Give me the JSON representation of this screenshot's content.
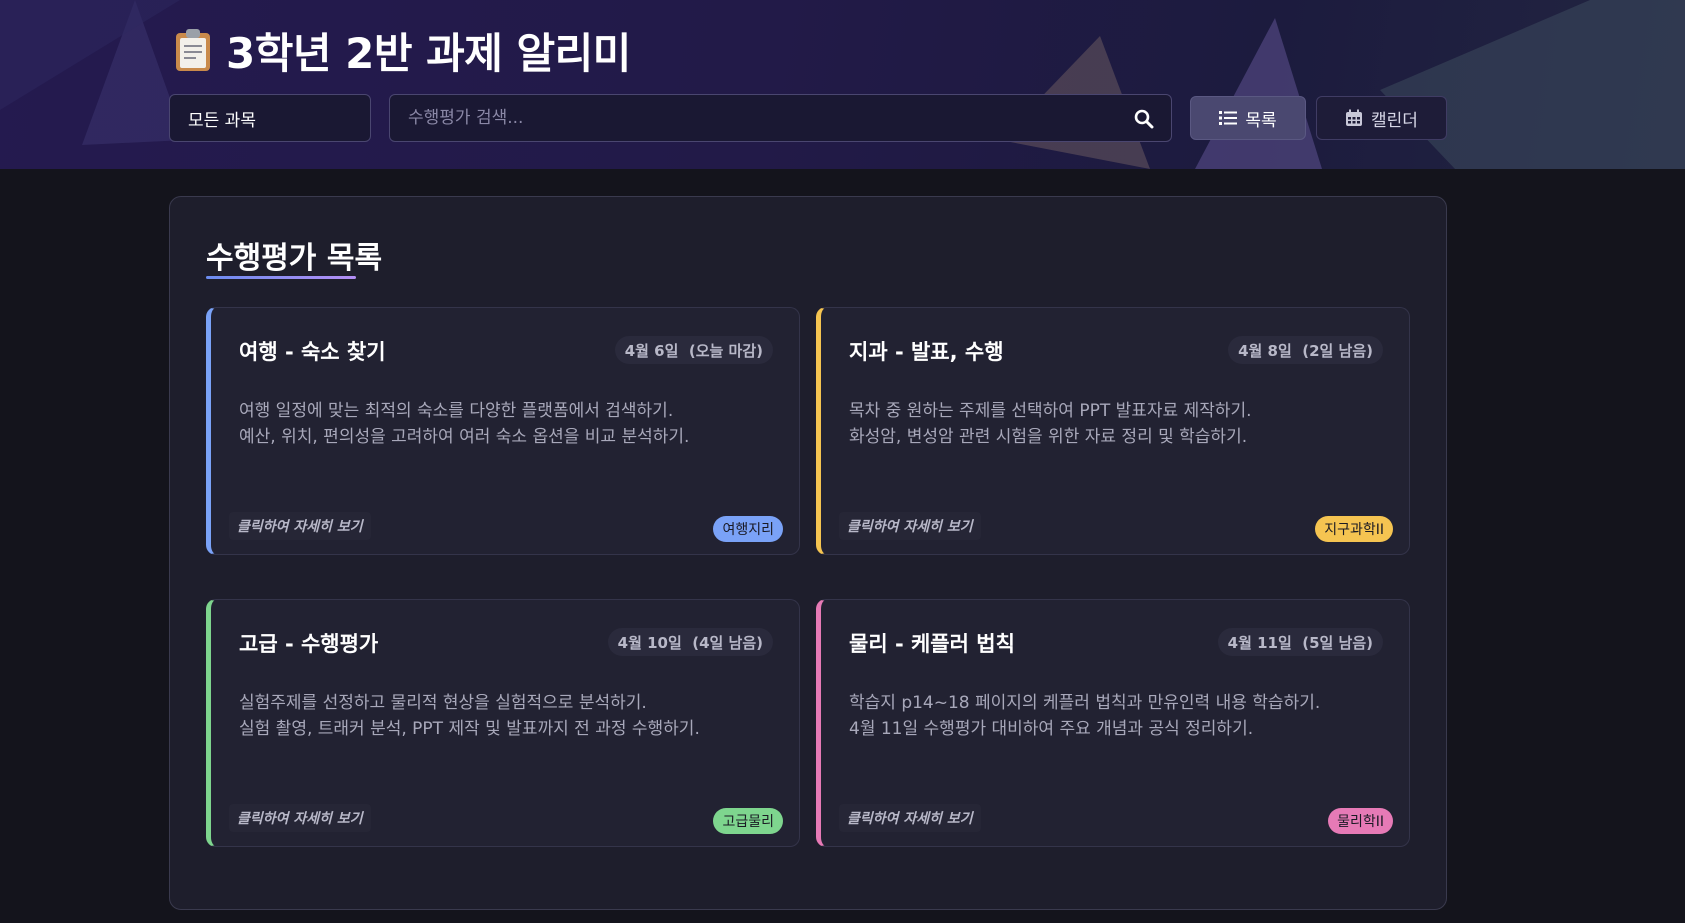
{
  "header": {
    "title": "3학년 2반 과제 알리미",
    "title_icon": "clipboard-icon"
  },
  "controls": {
    "subject_select_value": "모든 과목",
    "search_placeholder": "수행평가 검색...",
    "list_button_label": "목록",
    "calendar_button_label": "캘린더"
  },
  "panel": {
    "title": "수행평가 목록"
  },
  "cards": [
    {
      "title": "여행 - 숙소 찾기",
      "date": "4월 6일  (오늘 마감)",
      "desc_line1": "여행 일정에 맞는 최적의 숙소를 다양한 플랫폼에서 검색하기.",
      "desc_line2": "예산, 위치, 편의성을 고려하여 여러 숙소 옵션을 비교 분석하기.",
      "link": "클릭하여 자세히 보기",
      "badge": "여행지리",
      "color": "#7aa2f7"
    },
    {
      "title": "지과 - 발표, 수행",
      "date": "4월 8일  (2일 남음)",
      "desc_line1": "목차 중 원하는 주제를 선택하여 PPT 발표자료 제작하기.",
      "desc_line2": "화성암, 변성암 관련 시험을 위한 자료 정리 및 학습하기.",
      "link": "클릭하여 자세히 보기",
      "badge": "지구과학II",
      "color": "#f5c451"
    },
    {
      "title": "고급 - 수행평가",
      "date": "4월 10일  (4일 남음)",
      "desc_line1": "실험주제를 선정하고 물리적 현상을 실험적으로 분석하기.",
      "desc_line2": "실험 촬영, 트래커 분석, PPT 제작 및 발표까지 전 과정 수행하기.",
      "link": "클릭하여 자세히 보기",
      "badge": "고급물리",
      "color": "#7ed58e"
    },
    {
      "title": "물리 - 케플러 법칙",
      "date": "4월 11일  (5일 남음)",
      "desc_line1": "학습지 p14~18 페이지의 케플러 법칙과 만유인력 내용 학습하기.",
      "desc_line2": "4월 11일 수행평가 대비하여 주요 개념과 공식 정리하기.",
      "link": "클릭하여 자세히 보기",
      "badge": "물리학II",
      "color": "#e67ab6"
    }
  ]
}
